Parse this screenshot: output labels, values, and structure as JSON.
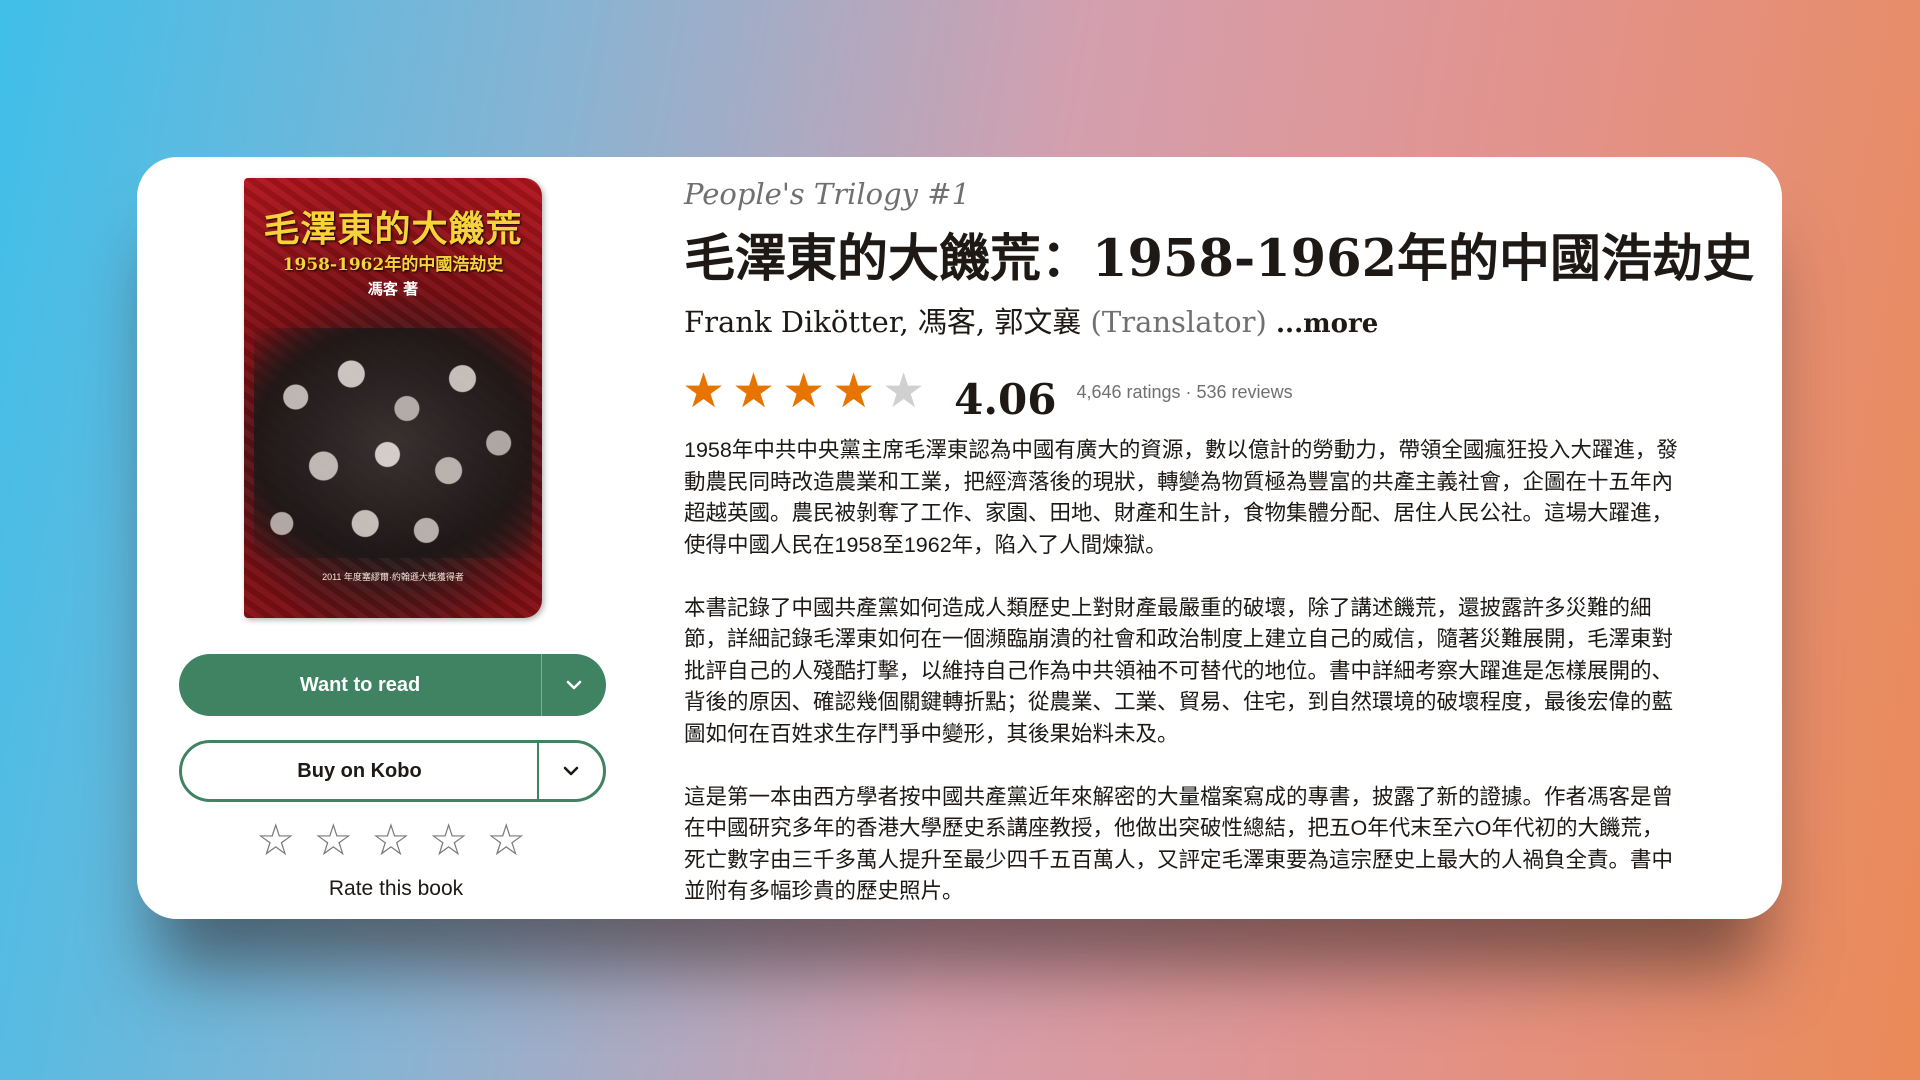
{
  "cover": {
    "title": "毛澤東的大饑荒",
    "subtitle": "1958-1962年的中國浩劫史",
    "author": "馮客 著",
    "award": "2011 年度塞繆爾·約翰遜大獎獲得者"
  },
  "actions": {
    "want_to_read": "Want to read",
    "buy_on_kobo": "Buy on Kobo",
    "chevron_icon": "chevron-down-icon"
  },
  "user_rating": {
    "stars": [
      "☆",
      "☆",
      "☆",
      "☆",
      "☆"
    ],
    "label": "Rate this book"
  },
  "book": {
    "series": "People's Trilogy #1",
    "title": "毛澤東的大饑荒：1958-1962年的中國浩劫史",
    "authors": "Frank Dikötter, 馮客, 郭文襄",
    "translator_role": "(Translator)",
    "more_link": "...more"
  },
  "rating": {
    "value": 4.06,
    "average_text": "4.06",
    "stars": [
      "★",
      "★",
      "★",
      "★",
      "★"
    ],
    "filled_stars": 4,
    "counts_text": "4,646 ratings · 536 reviews",
    "star_color": "#e87400"
  },
  "description": {
    "paragraphs": [
      "1958年中共中央黨主席毛澤東認為中國有廣大的資源，數以億計的勞動力，帶領全國瘋狂投入大躍進，發動農民同時改造農業和工業，把經濟落後的現狀，轉變為物質極為豐富的共產主義社會，企圖在十五年內超越英國。農民被剝奪了工作、家園、田地、財產和生計，食物集體分配、居住人民公社。這場大躍進，使得中國人民在1958至1962年，陷入了人間煉獄。",
      "本書記錄了中國共產黨如何造成人類歷史上對財產最嚴重的破壞，除了講述饑荒，還披露許多災難的細節，詳細記錄毛澤東如何在一個瀕臨崩潰的社會和政治制度上建立自己的威信，隨著災難展開，毛澤東對批評自己的人殘酷打擊，以維持自己作為中共領袖不可替代的地位。書中詳細考察大躍進是怎樣展開的、背後的原因、確認幾個關鍵轉折點；從農業、工業、貿易、住宅，到自然環境的破壞程度，最後宏偉的藍圖如何在百姓求生存鬥爭中變形，其後果始料未及。",
      "這是第一本由西方學者按中國共產黨近年來解密的大量檔案寫成的專書，披露了新的證據。作者馮客是曾在中國研究多年的香港大學歷史系講座教授，他做出突破性總結，把五O年代末至六O年代初的大饑荒，死亡數字由三千多萬人提升至最少四千五百萬人，又評定毛澤東要為這宗歷史上最大的人禍負全責。書中並附有多幅珍貴的歷史照片。"
    ]
  },
  "colors": {
    "primary_green": "#3f8363",
    "text_dark": "#1e1915",
    "text_muted": "#707070"
  }
}
